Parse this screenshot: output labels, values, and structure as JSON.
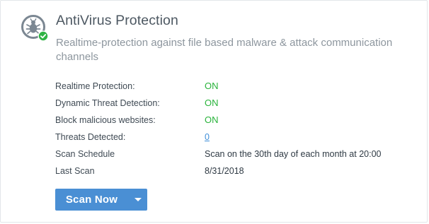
{
  "header": {
    "title": "AntiVirus Protection",
    "subtitle": "Realtime-protection against file based malware & attack communication channels",
    "icon": "bug-shield-check-icon"
  },
  "status_rows": [
    {
      "label": "Realtime Protection:",
      "value": "ON"
    },
    {
      "label": "Dynamic Threat Detection:",
      "value": "ON"
    },
    {
      "label": "Block malicious websites:",
      "value": "ON"
    },
    {
      "label": "Threats Detected:",
      "value": "0"
    },
    {
      "label": "Scan Schedule",
      "value": "Scan on the 30th day of each month at 20:00"
    },
    {
      "label": "Last Scan",
      "value": "8/31/2018"
    }
  ],
  "actions": {
    "scan_label": "Scan Now",
    "dropdown_icon": "caret-down-icon"
  },
  "colors": {
    "on": "#28b33a",
    "link": "#3f8fd9",
    "button": "#4a8fd4",
    "check_badge": "#2fb344",
    "icon_gray": "#7b8792"
  }
}
